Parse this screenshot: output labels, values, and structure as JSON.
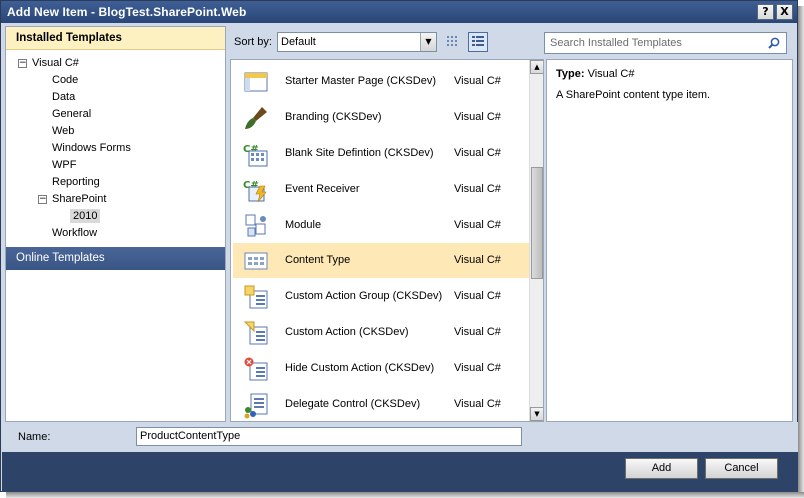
{
  "window": {
    "title": "Add New Item - BlogTest.SharePoint.Web",
    "help_label": "?",
    "close_label": "X"
  },
  "left_pane": {
    "header": "Installed Templates",
    "tree": [
      {
        "label": "Visual C#",
        "level": 0,
        "toggle": "−"
      },
      {
        "label": "Code",
        "level": 1
      },
      {
        "label": "Data",
        "level": 1
      },
      {
        "label": "General",
        "level": 1
      },
      {
        "label": "Web",
        "level": 1
      },
      {
        "label": "Windows Forms",
        "level": 1
      },
      {
        "label": "WPF",
        "level": 1
      },
      {
        "label": "Reporting",
        "level": 1
      },
      {
        "label": "SharePoint",
        "level": 1,
        "toggle": "−"
      },
      {
        "label": "2010",
        "level": 2,
        "selected": true
      },
      {
        "label": "Workflow",
        "level": 1
      }
    ],
    "online": "Online Templates"
  },
  "toolbar": {
    "sort_label": "Sort by:",
    "sort_value": "Default"
  },
  "templates": [
    {
      "name": "Starter Master Page (CKSDev)",
      "lang": "Visual C#",
      "icon": "master-page-icon"
    },
    {
      "name": "Branding (CKSDev)",
      "lang": "Visual C#",
      "icon": "paintbrush-icon"
    },
    {
      "name": "Blank Site Defintion (CKSDev)",
      "lang": "Visual C#",
      "icon": "site-definition-icon"
    },
    {
      "name": "Event Receiver",
      "lang": "Visual C#",
      "icon": "event-receiver-icon"
    },
    {
      "name": "Module",
      "lang": "Visual C#",
      "icon": "module-icon"
    },
    {
      "name": "Content Type",
      "lang": "Visual C#",
      "icon": "content-type-icon",
      "selected": true
    },
    {
      "name": "Custom Action Group (CKSDev)",
      "lang": "Visual C#",
      "icon": "custom-action-group-icon"
    },
    {
      "name": "Custom Action (CKSDev)",
      "lang": "Visual C#",
      "icon": "custom-action-icon"
    },
    {
      "name": "Hide Custom Action (CKSDev)",
      "lang": "Visual C#",
      "icon": "hide-custom-action-icon"
    },
    {
      "name": "Delegate Control (CKSDev)",
      "lang": "Visual C#",
      "icon": "delegate-control-icon"
    }
  ],
  "search": {
    "placeholder": "Search Installed Templates"
  },
  "details": {
    "type_label": "Type:",
    "type_value": "Visual C#",
    "description": "A SharePoint content type item."
  },
  "name_field": {
    "label": "Name:",
    "value": "ProductContentType"
  },
  "buttons": {
    "add": "Add",
    "cancel": "Cancel"
  },
  "colors": {
    "accent": "#2b4677",
    "selection": "#fde8b6",
    "header": "#fdf1c1"
  }
}
